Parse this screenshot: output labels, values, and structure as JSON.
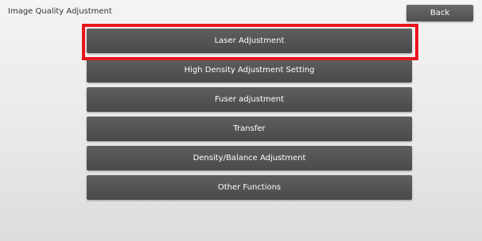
{
  "header": {
    "title": "Image Quality Adjustment",
    "back_label": "Back"
  },
  "menu": {
    "items": [
      {
        "label": "Laser Adjustment",
        "highlighted": true
      },
      {
        "label": "High Density Adjustment Setting"
      },
      {
        "label": "Fuser adjustment"
      },
      {
        "label": "Transfer"
      },
      {
        "label": "Density/Balance Adjustment"
      },
      {
        "label": "Other Functions"
      }
    ]
  },
  "colors": {
    "button_bg": "#555555",
    "button_text": "#ffffff",
    "highlight": "#e8141c",
    "background": "#ececec"
  }
}
